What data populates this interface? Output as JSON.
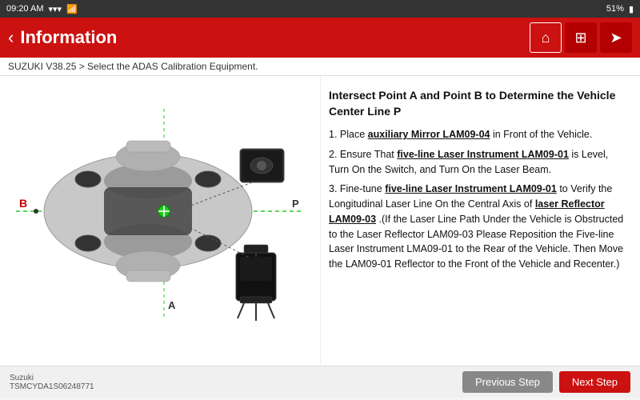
{
  "statusBar": {
    "time": "09:20 AM",
    "battery": "51%",
    "batteryIcon": "🔋"
  },
  "header": {
    "title": "Information",
    "backIcon": "‹",
    "homeIcon": "⌂",
    "diagIcon": "⊞",
    "exitIcon": "➤"
  },
  "breadcrumb": "SUZUKI V38.25 > Select the ADAS Calibration Equipment.",
  "instructionTitle": "Intersect Point A and Point B to Determine the Vehicle Center Line P",
  "instructions": [
    {
      "number": "1.",
      "text": "Place ",
      "highlighted": "auxiliary Mirror LAM09-04",
      "rest": " in Front of the Vehicle."
    },
    {
      "number": "2.",
      "text": "Ensure That ",
      "highlighted": "five-line Laser Instrument LAM09-01",
      "rest": " is Level, Turn On the Switch, and Turn On the Laser Beam."
    },
    {
      "number": "3.",
      "text": "Fine-tune ",
      "highlighted1": "five-line Laser Instrument LAM09-01",
      "middle": " to Verify the Longitudinal Laser Line On the Central Axis of ",
      "highlighted2": "laser Reflector LAM09-03",
      "end": " .(If the Laser Line Path Under the Vehicle is Obstructed to the Laser Reflector LAM09-03 Please Reposition the Five-line Laser Instrument LMA09-01 to the Rear of the Vehicle. Then Move the LAM09-01 Reflector to the Front of the Vehicle and Recenter.)"
    }
  ],
  "footer": {
    "brand": "Suzuki",
    "model": "TSMCYDA1S06248771",
    "previousStep": "Previous Step",
    "nextStep": "Next Step"
  },
  "labels": {
    "pointB": "B",
    "pointA": "A",
    "pointP": "P"
  }
}
